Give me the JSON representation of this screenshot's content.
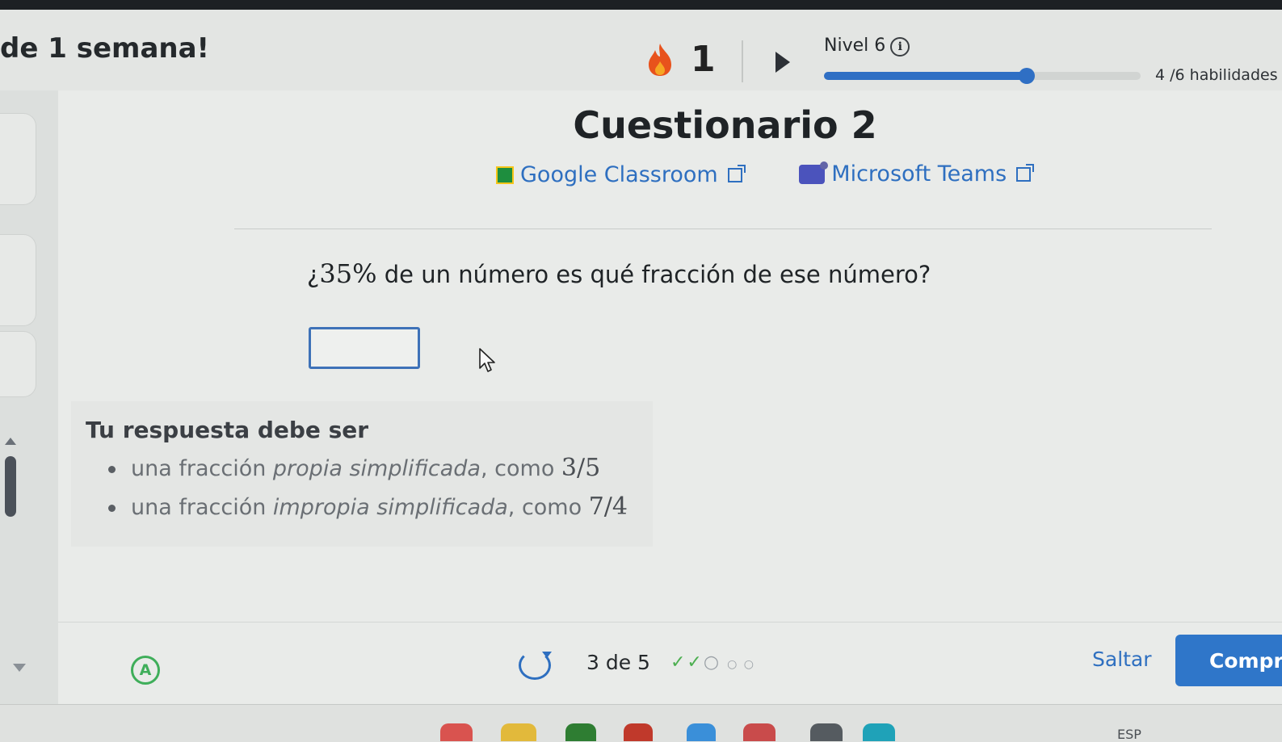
{
  "header": {
    "streak_text": "de 1 semana!",
    "streak_count": "1",
    "level_label": "Nivel 6",
    "level_progress": 0.64,
    "skills_text": "4 /6 habilidades"
  },
  "quiz": {
    "title": "Cuestionario 2",
    "share": {
      "google_classroom": "Google Classroom",
      "microsoft_teams": "Microsoft Teams"
    },
    "question_prefix": "¿",
    "question_math": "35%",
    "question_rest": " de un número es qué fracción de ese número?",
    "answer_value": "",
    "hint_title": "Tu respuesta debe ser",
    "hints": [
      {
        "pre": "una fracción ",
        "em": "propia simplificada",
        "post": ", como ",
        "math": "3/5"
      },
      {
        "pre": "una fracción ",
        "em": "impropia simplificada",
        "post": ", como ",
        "math": "7/4"
      }
    ]
  },
  "footer": {
    "a_label": "A",
    "counter": "3 de 5",
    "steps_done": "✓✓",
    "steps_current": "○",
    "steps_rest": "○ ○",
    "skip_label": "Saltar",
    "check_label": "Comprobar"
  },
  "taskbar": {
    "language": "ESP"
  },
  "colors": {
    "accent": "#2f76c9",
    "flame": "#e8521c",
    "success": "#4caf50"
  }
}
